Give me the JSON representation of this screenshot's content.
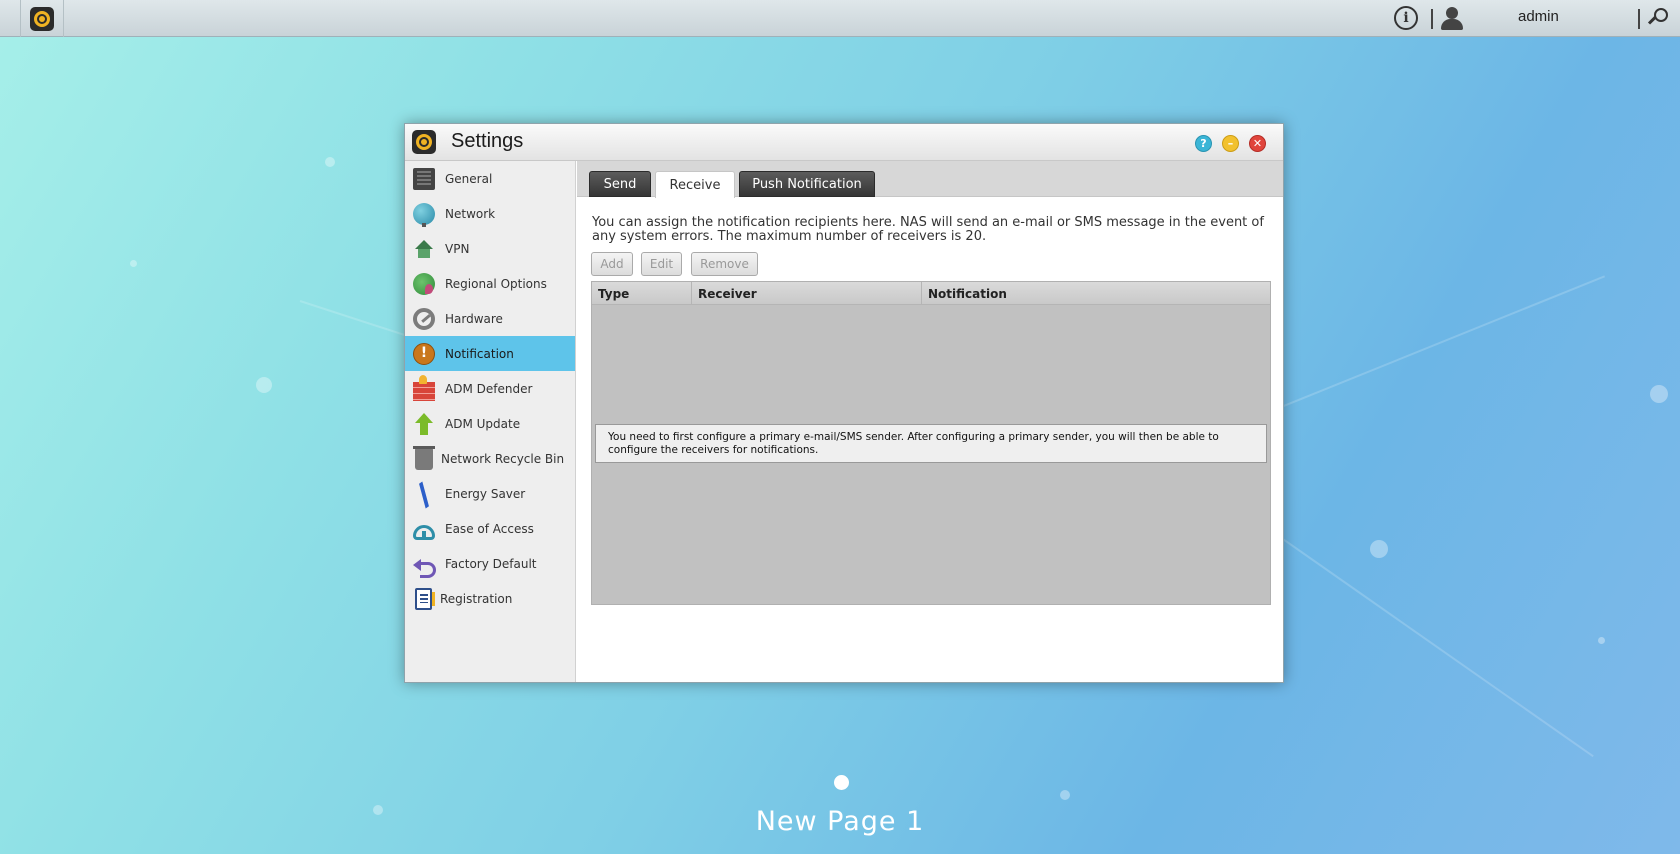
{
  "topbar": {
    "user_name": "admin",
    "icons": [
      "app-launcher-icon",
      "info-icon",
      "user-icon",
      "search-icon"
    ]
  },
  "window": {
    "title": "Settings",
    "controls": [
      "help-icon",
      "minimize-icon",
      "close-icon"
    ],
    "colors": {
      "help": "#3bb5d6",
      "minimize": "#f2c12e",
      "close": "#e0453c",
      "active_item": "#5ec4ea"
    }
  },
  "sidebar": {
    "active": "Notification",
    "items": [
      {
        "label": "General",
        "icon": "general-icon"
      },
      {
        "label": "Network",
        "icon": "network-globe-icon"
      },
      {
        "label": "VPN",
        "icon": "vpn-house-icon"
      },
      {
        "label": "Regional Options",
        "icon": "regional-globe-icon"
      },
      {
        "label": "Hardware",
        "icon": "hardware-wrench-icon"
      },
      {
        "label": "Notification",
        "icon": "notification-alert-icon"
      },
      {
        "label": "ADM Defender",
        "icon": "defender-firewall-icon"
      },
      {
        "label": "ADM Update",
        "icon": "update-arrow-icon"
      },
      {
        "label": "Network Recycle Bin",
        "icon": "recycle-bin-icon"
      },
      {
        "label": "Energy Saver",
        "icon": "energy-bolt-icon"
      },
      {
        "label": "Ease of Access",
        "icon": "cloud-access-icon"
      },
      {
        "label": "Factory Default",
        "icon": "factory-reset-icon"
      },
      {
        "label": "Registration",
        "icon": "registration-icon"
      }
    ]
  },
  "tabs": {
    "active": "Receive",
    "items": [
      {
        "label": "Send"
      },
      {
        "label": "Receive"
      },
      {
        "label": "Push Notification"
      }
    ]
  },
  "receive": {
    "description": "You can assign the notification recipients here. NAS will send an e-mail or SMS message in the event of any system errors. The maximum number of receivers is 20.",
    "buttons": {
      "add": "Add",
      "edit": "Edit",
      "remove": "Remove"
    },
    "table": {
      "columns": [
        "Type",
        "Receiver",
        "Notification"
      ],
      "rows": []
    },
    "empty_message": "You need to first configure a primary e-mail/SMS sender. After configuring a primary sender, you will then be able to configure the receivers for notifications."
  },
  "desktop": {
    "page_label": "New Page 1"
  }
}
